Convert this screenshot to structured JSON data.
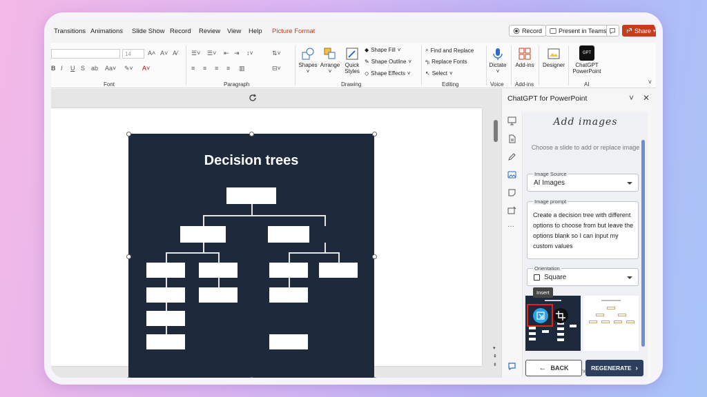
{
  "ribbon_tabs": [
    "Transitions",
    "Animations",
    "Slide Show",
    "Record",
    "Review",
    "View",
    "Help",
    "Picture Format"
  ],
  "active_tab": "Picture Format",
  "top_buttons": {
    "record": "Record",
    "present": "Present in Teams",
    "share": "Share"
  },
  "font_group": {
    "size": "14",
    "label": "Font"
  },
  "paragraph_group": {
    "label": "Paragraph"
  },
  "drawing_group": {
    "label": "Drawing",
    "shapes": "Shapes",
    "arrange": "Arrange",
    "quick_styles_1": "Quick",
    "quick_styles_2": "Styles",
    "shape_fill": "Shape Fill",
    "shape_outline": "Shape Outline",
    "shape_effects": "Shape Effects"
  },
  "editing_group": {
    "label": "Editing",
    "find_replace": "Find and Replace",
    "replace_fonts": "Replace Fonts",
    "select": "Select"
  },
  "voice_group": {
    "label": "Voice",
    "dictate": "Dictate"
  },
  "addins_group": {
    "label": "Add-ins",
    "addins": "Add-ins"
  },
  "designer": {
    "label": "Designer"
  },
  "ai_group": {
    "label": "AI",
    "chatgpt_1": "ChatGPT",
    "chatgpt_2": "PowerPoint"
  },
  "slide": {
    "title": "Decision trees"
  },
  "pane": {
    "title": "ChatGPT for PowerPoint",
    "heading": "Add images",
    "hint": "Choose a slide to add or replace image",
    "image_source_label": "Image Source",
    "image_source_value": "AI Images",
    "prompt_label": "Image prompt",
    "prompt_text": "Create a decision tree with different options to choose from but leave the options blank so I can input my custom values",
    "orientation_label": "Orientation",
    "orientation_value": "Square",
    "insert_tooltip": "Insert",
    "generated_by": "Photos generated by:",
    "generated_by_link": "AI",
    "back": "BACK",
    "regenerate": "REGENERATE"
  },
  "colors": {
    "accent": "#c43e1c",
    "slide_bg": "#1e2a3c",
    "regen": "#2d3e5c",
    "highlight": "#e0241c"
  }
}
